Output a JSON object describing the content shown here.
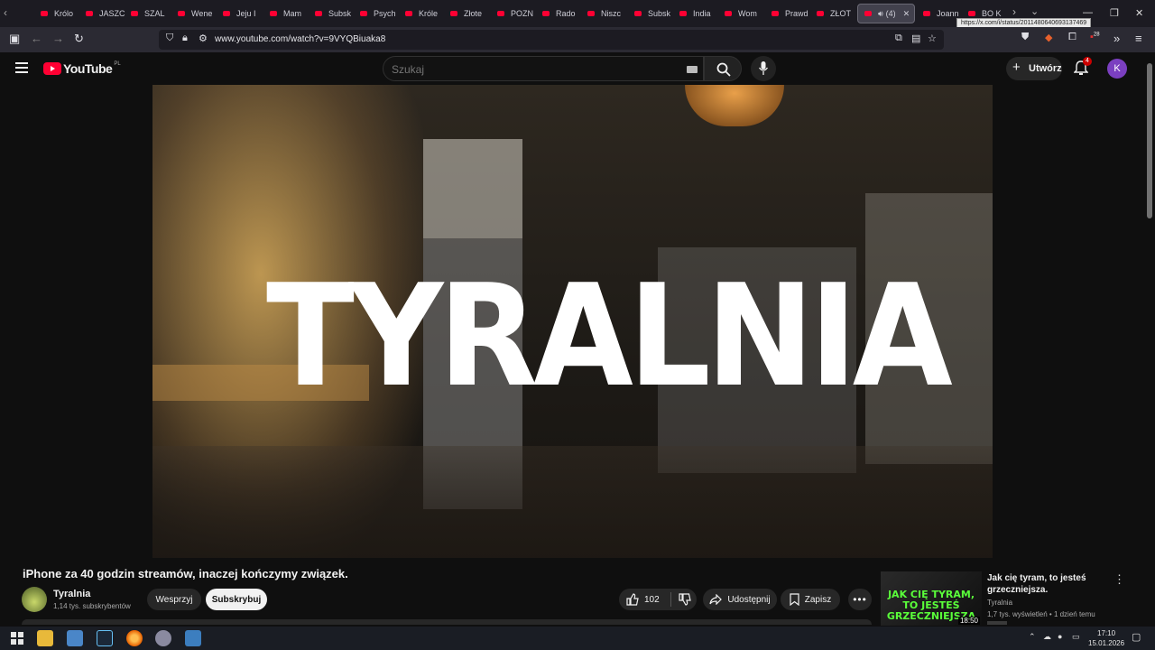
{
  "browser": {
    "tabs": [
      {
        "label": "Królo"
      },
      {
        "label": "JASZC"
      },
      {
        "label": "SZAL"
      },
      {
        "label": "Wene"
      },
      {
        "label": "Jeju I"
      },
      {
        "label": "Mam"
      },
      {
        "label": "Subsk"
      },
      {
        "label": "Psych"
      },
      {
        "label": "Króle"
      },
      {
        "label": "Złote"
      },
      {
        "label": "POZN"
      },
      {
        "label": "Rado"
      },
      {
        "label": "Niszc"
      },
      {
        "label": "Subsk"
      },
      {
        "label": "India"
      },
      {
        "label": "Wom"
      },
      {
        "label": "Prawd"
      },
      {
        "label": "ZŁOT"
      },
      {
        "label": "(4)",
        "active": true
      },
      {
        "label": "Joann"
      },
      {
        "label": "BO K"
      }
    ],
    "tooltip_url": "https://x.com/i/status/2011480640693137469",
    "url": "www.youtube.com/watch?v=9VYQBiuaka8",
    "extension_badge": "28"
  },
  "youtube": {
    "logo_text": "YouTube",
    "region": "PL",
    "search_placeholder": "Szukaj",
    "create_label": "Utwórz",
    "notifications_count": "4",
    "account_initial": "K"
  },
  "video": {
    "overlay_text": "TYRALNIA",
    "title": "iPhone za 40 godzin streamów, inaczej kończymy związek.",
    "channel_name": "Tyralnia",
    "channel_subs": "1,14 tys. subskrybentów",
    "support_label": "Wesprzyj",
    "subscribe_label": "Subskrybuj",
    "likes": "102",
    "share_label": "Udostępnij",
    "save_label": "Zapisz"
  },
  "recommendation": {
    "thumb_text": "JAK CIĘ TYRAM, TO JESTEŚ GRZECZNIEJSZA",
    "duration": "18:50",
    "title": "Jak cię tyram, to jesteś grzeczniejsza.",
    "channel": "Tyralnia",
    "meta": "1,7 tys. wyświetleń • 1 dzień temu"
  },
  "taskbar": {
    "time": "17:10",
    "date": "15.01.2026"
  },
  "colors": {
    "youtube_red": "#ff0033",
    "background": "#0f0f0f",
    "avatar_purple": "#7b3fc0",
    "thumb_green": "#5aff3a"
  }
}
